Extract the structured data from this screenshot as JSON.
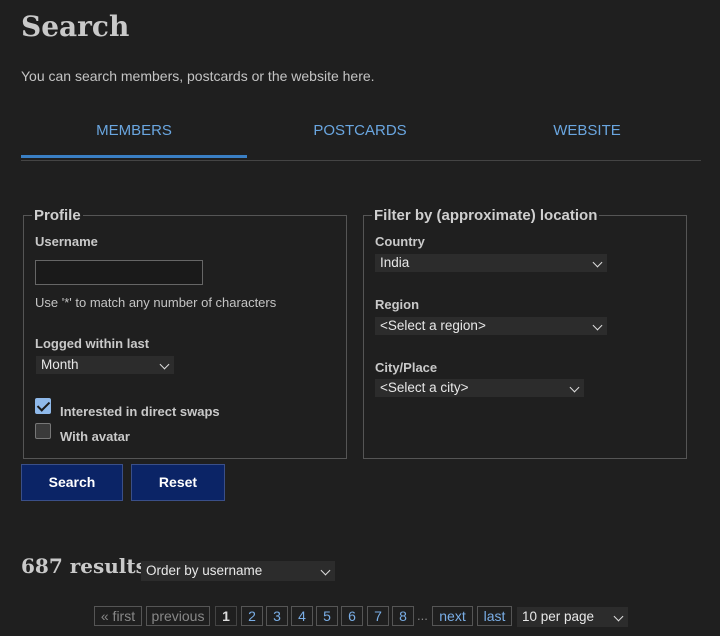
{
  "header": {
    "title": "Search",
    "intro": "You can search members, postcards or the website here."
  },
  "tabs": [
    {
      "label": "MEMBERS",
      "active": true
    },
    {
      "label": "POSTCARDS",
      "active": false
    },
    {
      "label": "WEBSITE",
      "active": false
    }
  ],
  "profile": {
    "legend": "Profile",
    "username_label": "Username",
    "username_value": "",
    "username_hint": "Use '*' to match any number of characters",
    "logged_label": "Logged within last",
    "logged_value": "Month",
    "swaps_label": "Interested in direct swaps",
    "swaps_checked": true,
    "avatar_label": "With avatar",
    "avatar_checked": false
  },
  "location": {
    "legend": "Filter by (approximate) location",
    "country_label": "Country",
    "country_value": "India",
    "region_label": "Region",
    "region_value": "<Select a region>",
    "city_label": "City/Place",
    "city_value": "<Select a city>"
  },
  "buttons": {
    "search": "Search",
    "reset": "Reset"
  },
  "results": {
    "count_text": "687 results",
    "order_value": "Order by username"
  },
  "pager": {
    "first": "« first",
    "previous": "previous",
    "pages": [
      "1",
      "2",
      "3",
      "4",
      "5",
      "6",
      "7",
      "8"
    ],
    "current": "1",
    "ellipsis": "...",
    "next": "next",
    "last": "last",
    "per_page_value": "10 per page"
  },
  "colors": {
    "background": "#1f1f1f",
    "accent": "#6aa6e0",
    "button": "#0b2466",
    "checkbox": "#8fb9ea"
  }
}
